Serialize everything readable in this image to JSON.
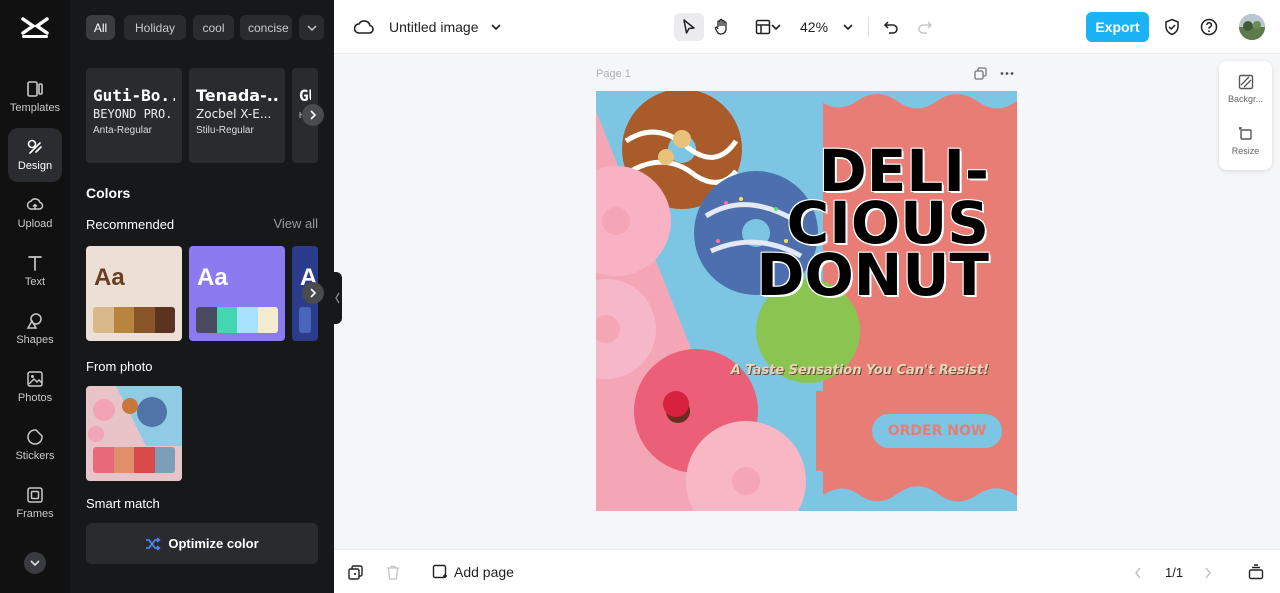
{
  "rail": {
    "items": [
      {
        "label": "Templates",
        "icon": "templates-icon"
      },
      {
        "label": "Design",
        "icon": "design-icon"
      },
      {
        "label": "Upload",
        "icon": "upload-icon"
      },
      {
        "label": "Text",
        "icon": "text-icon"
      },
      {
        "label": "Shapes",
        "icon": "shapes-icon"
      },
      {
        "label": "Photos",
        "icon": "photos-icon"
      },
      {
        "label": "Stickers",
        "icon": "stickers-icon"
      },
      {
        "label": "Frames",
        "icon": "frames-icon"
      }
    ]
  },
  "panel": {
    "chips": [
      "All",
      "Holiday",
      "cool",
      "concise"
    ],
    "fonts": [
      {
        "display": "Guti-Bo...",
        "secondary": "BEYOND PRO...",
        "name": "Anta-Regular"
      },
      {
        "display": "Tenada-...",
        "secondary": "Zocbel X-E...",
        "name": "Stilu-Regular"
      },
      {
        "display": "GU",
        "secondary": "",
        "name": "Ham"
      }
    ],
    "colors_title": "Colors",
    "recommended_label": "Recommended",
    "view_all": "View all",
    "palettes": [
      {
        "sample": "Aa",
        "bg": "#ece0d6",
        "fg": "#6b3e22",
        "swatches": [
          "#d9b98a",
          "#b9843f",
          "#8a5528",
          "#5a3420"
        ]
      },
      {
        "sample": "Aa",
        "bg": "#8a7cf0",
        "fg": "#ffffff",
        "swatches": [
          "#4a4a63",
          "#43d6b0",
          "#a8e2ff",
          "#f3ecd1"
        ]
      },
      {
        "sample": "A",
        "bg": "#2b3c8c",
        "fg": "#ffffff",
        "swatches": [
          "#4a66b8"
        ]
      }
    ],
    "from_photo_label": "From photo",
    "photo_swatches": [
      "#e86a7a",
      "#e0906a",
      "#d94a4a",
      "#7aa0b8"
    ],
    "smart_match_label": "Smart match",
    "optimize_label": "Optimize color"
  },
  "topbar": {
    "title": "Untitled image",
    "zoom": "42%",
    "export_label": "Export"
  },
  "canvas": {
    "page_label": "Page 1",
    "headline": [
      "DELI-",
      "CIOUS",
      "DONUT"
    ],
    "tagline": "A Taste Sensation You Can't Resist!",
    "cta": "ORDER NOW"
  },
  "right_panel": {
    "background_label": "Backgr...",
    "resize_label": "Resize"
  },
  "bottombar": {
    "add_page": "Add page",
    "pager": "1/1"
  },
  "colors": {
    "accent": "#1bb3f3",
    "poster_pink": "#e87d76",
    "poster_blue": "#7cc5e3"
  }
}
